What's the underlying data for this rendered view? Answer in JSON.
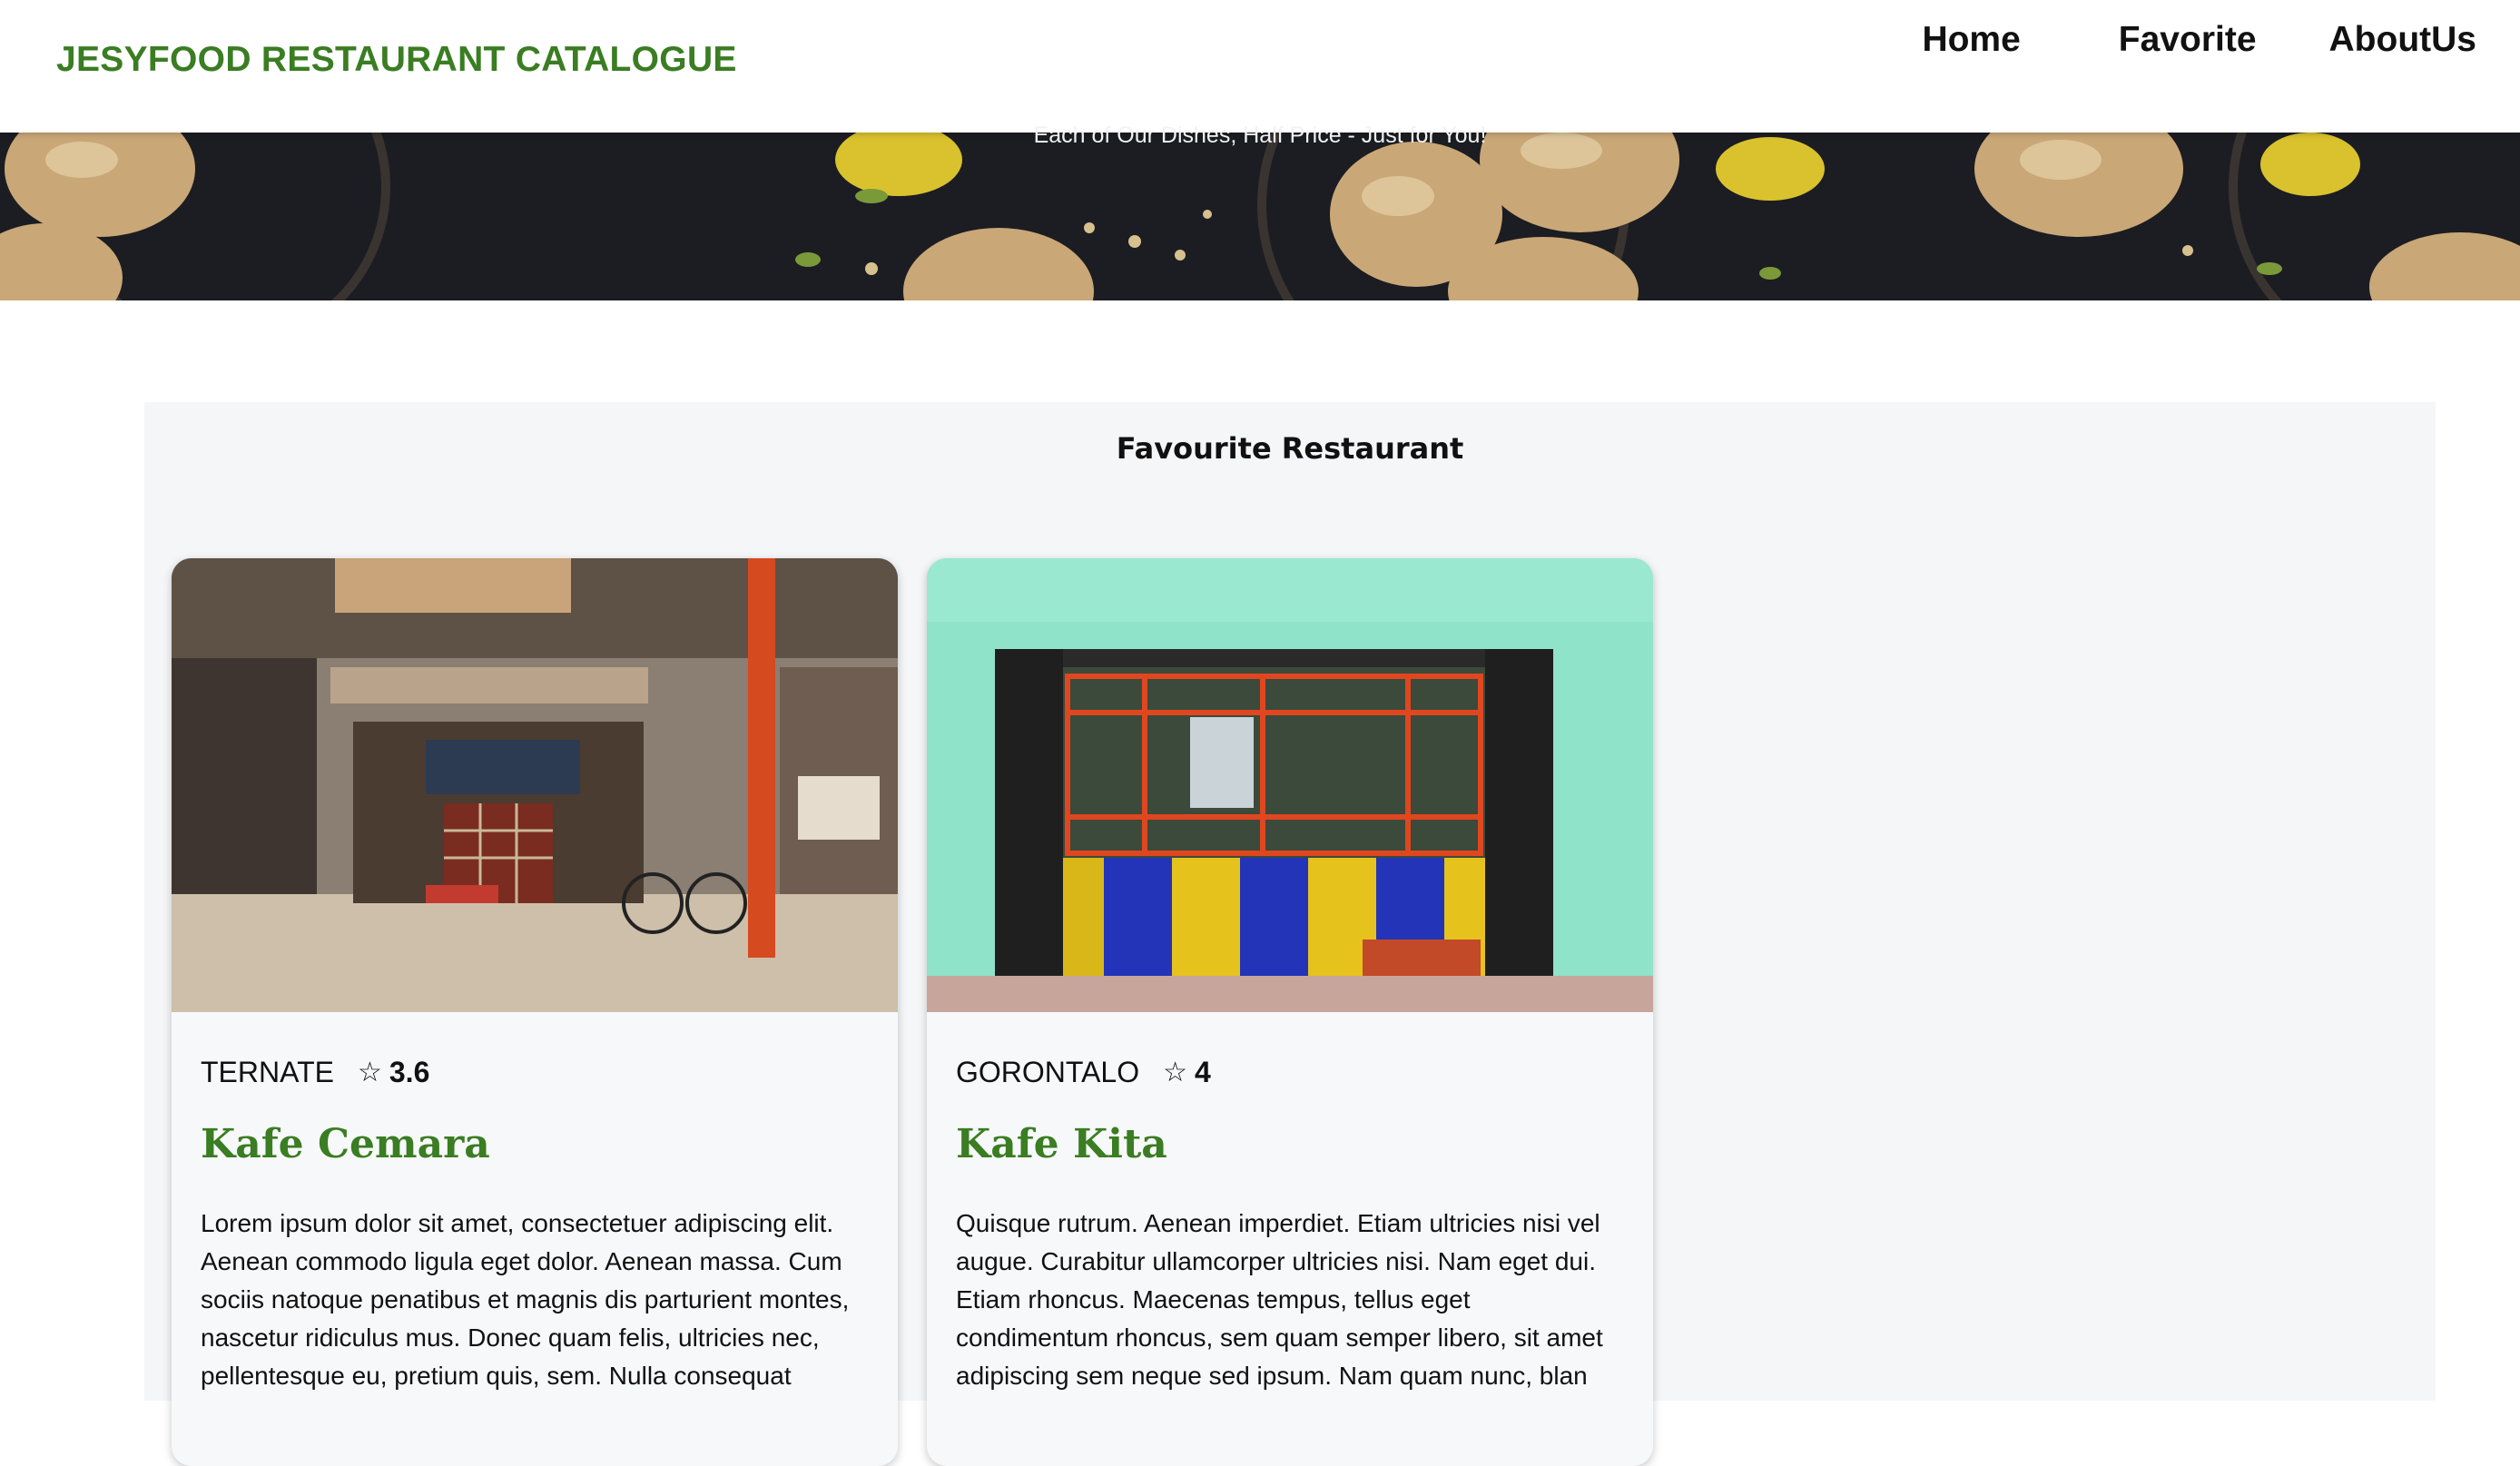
{
  "header": {
    "brand": "JESYFOOD RESTAURANT CATALOGUE",
    "nav": [
      {
        "label": "Home"
      },
      {
        "label": "Favorite"
      },
      {
        "label": "AboutUs"
      }
    ]
  },
  "hero": {
    "tagline": "Each of Our Dishes, Half Price - Just for You!"
  },
  "favourites": {
    "title": "Favourite Restaurant",
    "restaurants": [
      {
        "city": "TERNATE",
        "rating": "3.6",
        "name": "Kafe Cemara",
        "description": "Lorem ipsum dolor sit amet, consectetuer adipiscing elit. Aenean commodo ligula eget dolor. Aenean massa. Cum sociis natoque penatibus et magnis dis parturient montes, nascetur ridiculus mus. Donec quam felis, ultricies nec, pellentesque eu, pretium quis, sem. Nulla consequat"
      },
      {
        "city": "GORONTALO",
        "rating": "4",
        "name": "Kafe Kita",
        "description": "Quisque rutrum. Aenean imperdiet. Etiam ultricies nisi vel augue. Curabitur ullamcorper ultricies nisi. Nam eget dui. Etiam rhoncus. Maecenas tempus, tellus eget condimentum rhoncus, sem quam semper libero, sit amet adipiscing sem neque sed ipsum. Nam quam nunc, blan"
      }
    ]
  },
  "colors": {
    "brand_green": "#3a7d22",
    "section_bg": "#f5f6f8",
    "hero_bg": "#1c1d22"
  },
  "icons": {
    "rating": "star-outline-icon"
  }
}
